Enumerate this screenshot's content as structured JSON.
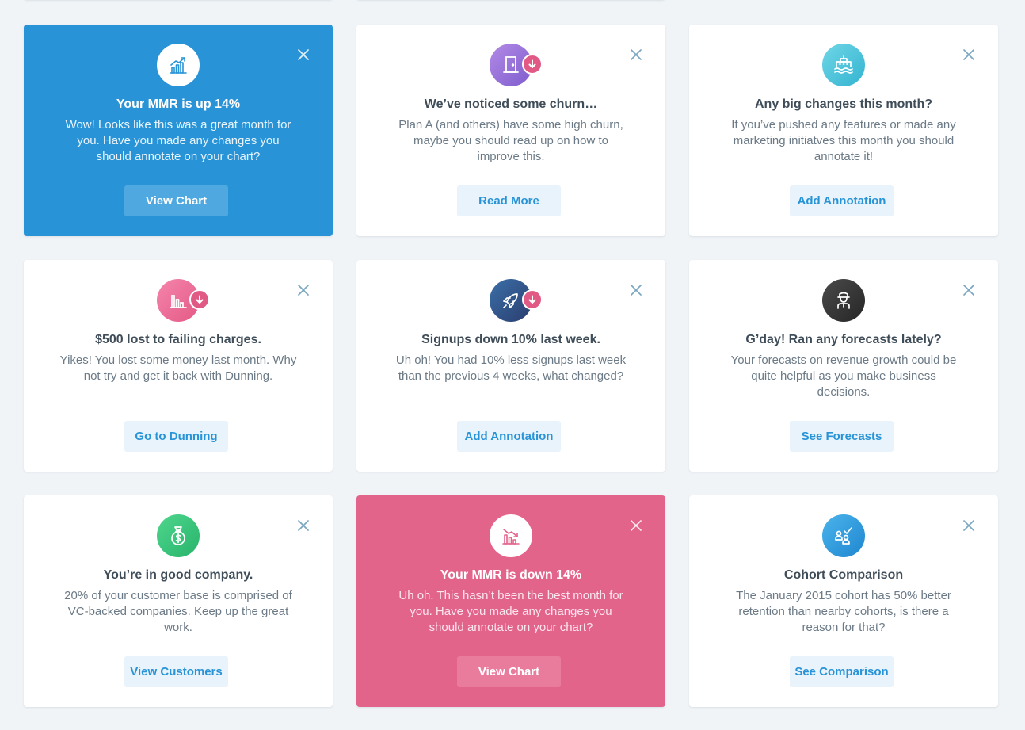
{
  "cards": [
    {
      "title": "Your MMR is up 14%",
      "description": "Wow! Looks like this was a great month for you. Have you made any changes you should annotate on your chart?",
      "button": "View Chart",
      "icon": "chart-up-icon",
      "variant": "blue"
    },
    {
      "title": "We’ve noticed some churn…",
      "description": "Plan A (and others) have some high churn, maybe you should read up on how to improve this.",
      "button": "Read More",
      "icon": "door-exit-icon",
      "badge": "arrow-down-icon"
    },
    {
      "title": "Any big changes this month?",
      "description": "If you’ve pushed any features or made any marketing initiatves this month you should annotate it!",
      "button": "Add Annotation",
      "icon": "ship-icon"
    },
    {
      "title": "$500 lost to failing charges.",
      "description": "Yikes! You lost some money last month. Why not try and get it back with Dunning.",
      "button": "Go to Dunning",
      "icon": "bar-chart-icon",
      "badge": "arrow-down-icon"
    },
    {
      "title": "Signups down 10% last week.",
      "description": "Uh oh! You had 10% less signups last week than the previous 4 weeks, what changed?",
      "button": "Add Annotation",
      "icon": "rocket-icon",
      "badge": "arrow-down-icon"
    },
    {
      "title": "G’day! Ran any forecasts lately?",
      "description": "Your forecasts on revenue growth could be quite helpful as you make business decisions.",
      "button": "See Forecasts",
      "icon": "forecaster-person-icon"
    },
    {
      "title": "You’re in good company.",
      "description": "20% of your customer base is comprised of VC-backed companies. Keep up the great work.",
      "button": "View Customers",
      "icon": "money-bag-icon"
    },
    {
      "title": "Your MMR is down 14%",
      "description": "Uh oh. This hasn’t been the best month for you. Have you made any changes you should annotate on your chart?",
      "button": "View Chart",
      "icon": "chart-down-icon",
      "variant": "pink"
    },
    {
      "title": "Cohort Comparison",
      "description": "The January 2015 cohort has 50% better retention than nearby cohorts, is there a reason for that?",
      "button": "See Comparison",
      "icon": "cohort-check-icon"
    }
  ],
  "colors": {
    "background": "#f0f4f7",
    "blue_card": "#2894d7",
    "pink_card": "#e3648b",
    "button_text": "#2894d7",
    "button_bg": "#e9f3fb",
    "badge": "#e15a86"
  }
}
